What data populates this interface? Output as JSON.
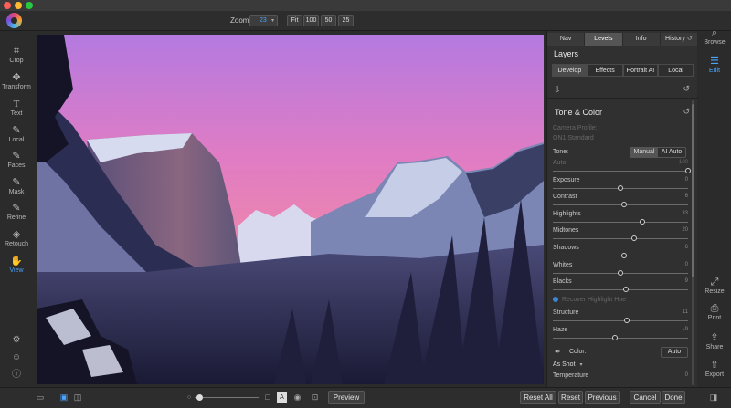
{
  "toolbar": {
    "zoom_label": "Zoom",
    "zoom_value": "23",
    "fit": "Fit",
    "z100": "100",
    "z50": "50",
    "z25": "25"
  },
  "left_tools": [
    {
      "label": "Crop",
      "icon": "crop-icon"
    },
    {
      "label": "Transform",
      "icon": "transform-icon"
    },
    {
      "label": "Text",
      "icon": "text-icon"
    },
    {
      "label": "Local",
      "icon": "local-brush-icon"
    },
    {
      "label": "Faces",
      "icon": "faces-icon"
    },
    {
      "label": "Mask",
      "icon": "mask-icon"
    },
    {
      "label": "Refine",
      "icon": "refine-icon"
    },
    {
      "label": "Retouch",
      "icon": "retouch-icon"
    },
    {
      "label": "View",
      "icon": "view-icon",
      "active": true
    }
  ],
  "right_tools": [
    {
      "label": "Browse",
      "icon": "browse-icon"
    },
    {
      "label": "Edit",
      "icon": "edit-icon",
      "active": true
    },
    {
      "label": "Resize",
      "icon": "resize-icon"
    },
    {
      "label": "Print",
      "icon": "print-icon"
    },
    {
      "label": "Share",
      "icon": "share-icon"
    },
    {
      "label": "Export",
      "icon": "export-icon"
    }
  ],
  "panel": {
    "tabs": [
      "Nav",
      "Levels",
      "Info",
      "History"
    ],
    "active_tab": "Levels",
    "layers_title": "Layers",
    "module_tabs": [
      "Develop",
      "Effects",
      "Portrait AI",
      "Local"
    ],
    "active_module": "Develop",
    "section_title": "Tone & Color",
    "camera_profile_label": "Camera Profile:",
    "camera_profile_value": "ON1 Standard",
    "tone_label": "Tone:",
    "tone_modes": [
      "Manual",
      "AI Auto"
    ],
    "sliders": [
      {
        "name": "Auto",
        "value": "100",
        "position": 1.0,
        "dim": true
      },
      {
        "name": "Exposure",
        "value": "0",
        "position": 0.5
      },
      {
        "name": "Contrast",
        "value": "6",
        "position": 0.53
      },
      {
        "name": "Highlights",
        "value": "33",
        "position": 0.66
      },
      {
        "name": "Midtones",
        "value": "20",
        "position": 0.6
      },
      {
        "name": "Shadows",
        "value": "6",
        "position": 0.53
      },
      {
        "name": "Whites",
        "value": "0",
        "position": 0.5
      },
      {
        "name": "Blacks",
        "value": "9",
        "position": 0.54
      }
    ],
    "recover_label": "Recover Highlight Hue",
    "sliders2": [
      {
        "name": "Structure",
        "value": "11",
        "position": 0.55
      },
      {
        "name": "Haze",
        "value": "-9",
        "position": 0.46
      }
    ],
    "color_label": "Color:",
    "color_auto": "Auto",
    "white_balance": "As Shot",
    "temperature_label": "Temperature",
    "temperature_value": "0"
  },
  "bottom": {
    "preview": "Preview",
    "reset_all": "Reset All",
    "reset": "Reset",
    "previous": "Previous",
    "cancel": "Cancel",
    "done": "Done"
  },
  "colors": {
    "accent": "#4aa3ff",
    "background": "#2b2b2b",
    "panel": "#303030"
  }
}
